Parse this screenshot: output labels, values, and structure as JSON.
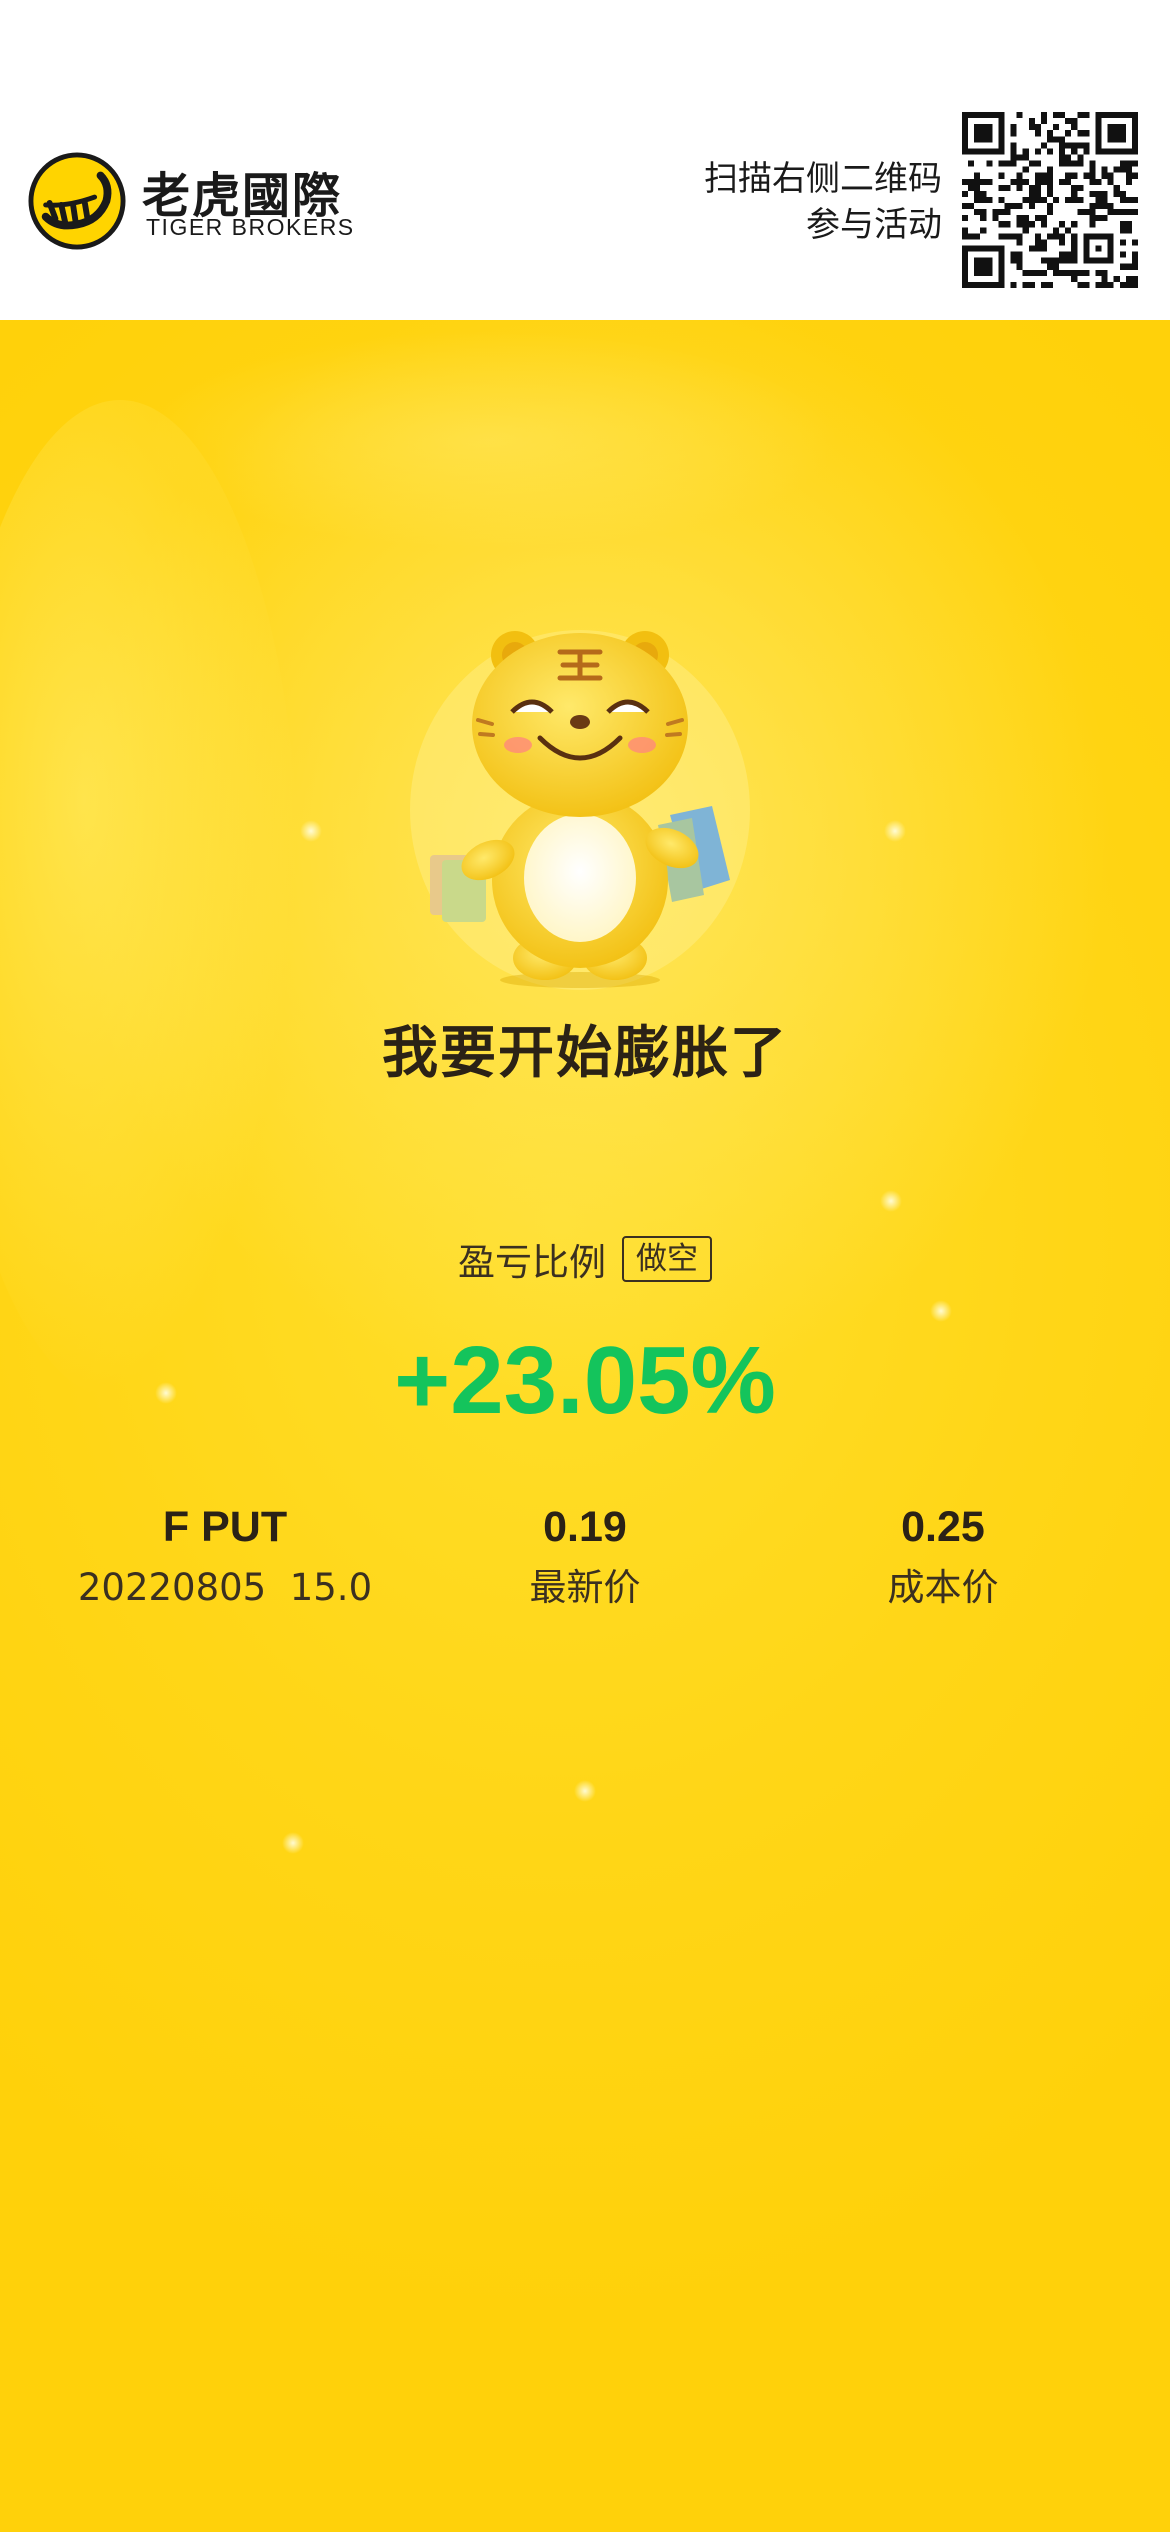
{
  "header": {
    "brand_cn": "老虎國際",
    "brand_en": "TIGER BROKERS",
    "scan_line1": "扫描右侧二维码",
    "scan_line2": "参与活动"
  },
  "card": {
    "slogan": "我要开始膨胀了",
    "ratio_label": "盈亏比例",
    "direction_tag": "做空",
    "pnl_ratio": "+23.05%",
    "colors": {
      "background": "#ffd617",
      "profit": "#14c45c",
      "text": "#2b2216"
    },
    "stats": [
      {
        "value": "F PUT",
        "label": "20220805  15.0"
      },
      {
        "value": "0.19",
        "label": "最新价"
      },
      {
        "value": "0.25",
        "label": "成本价"
      }
    ]
  },
  "icons": {
    "logo": "tiger-stripes-logo-icon",
    "qr": "qr-code-icon",
    "mascot": "tiger-mascot-icon"
  }
}
